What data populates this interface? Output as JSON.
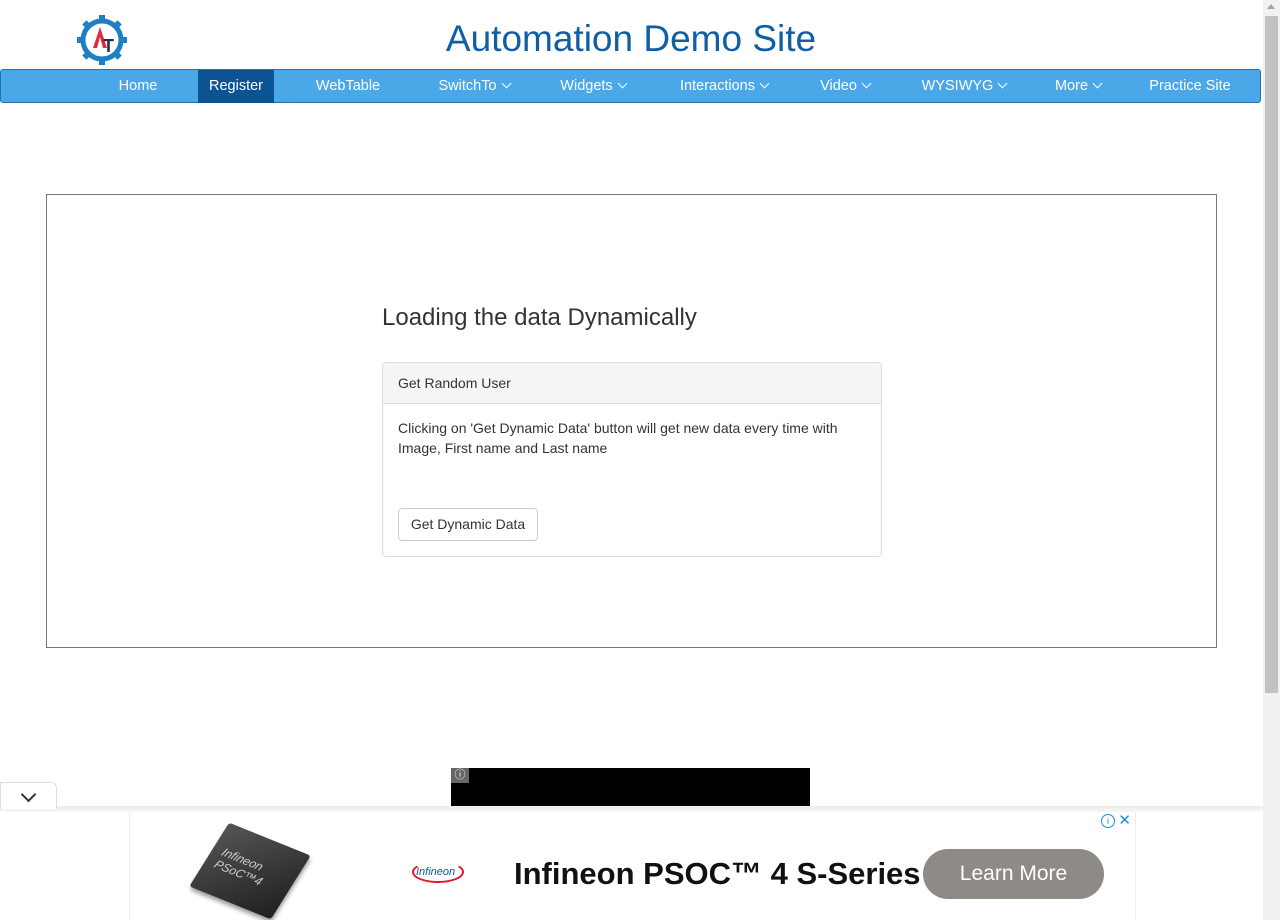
{
  "header": {
    "title": "Automation Demo Site",
    "logo_icon": "gear-logo-icon",
    "logo_letters": "AT"
  },
  "nav": {
    "items": [
      {
        "label": "Home",
        "has_caret": false,
        "active": false
      },
      {
        "label": "Register",
        "has_caret": false,
        "active": true
      },
      {
        "label": "WebTable",
        "has_caret": false,
        "active": false
      },
      {
        "label": "SwitchTo",
        "has_caret": true,
        "active": false
      },
      {
        "label": "Widgets",
        "has_caret": true,
        "active": false
      },
      {
        "label": "Interactions",
        "has_caret": true,
        "active": false
      },
      {
        "label": "Video",
        "has_caret": true,
        "active": false
      },
      {
        "label": "WYSIWYG",
        "has_caret": true,
        "active": false
      },
      {
        "label": "More",
        "has_caret": true,
        "active": false
      },
      {
        "label": "Practice Site",
        "has_caret": false,
        "active": false
      }
    ]
  },
  "main": {
    "section_title": "Loading the data Dynamically",
    "panel": {
      "heading": "Get Random User",
      "description": "Clicking on 'Get Dynamic Data' button will get new data every time with Image, First name and Last name",
      "button_label": "Get Dynamic Data"
    }
  },
  "ads": {
    "video_info_icon": "info-icon",
    "bottom": {
      "brand": "Infineon",
      "chip_label": "Infineon PSoC™4",
      "headline": "Infineon PSOC™ 4 S-Series",
      "cta": "Learn More"
    }
  },
  "colors": {
    "nav_bg": "#4aa7e8",
    "nav_active": "#0c5394",
    "title": "#0e5fa5",
    "cta_bg": "#8e8a86"
  }
}
